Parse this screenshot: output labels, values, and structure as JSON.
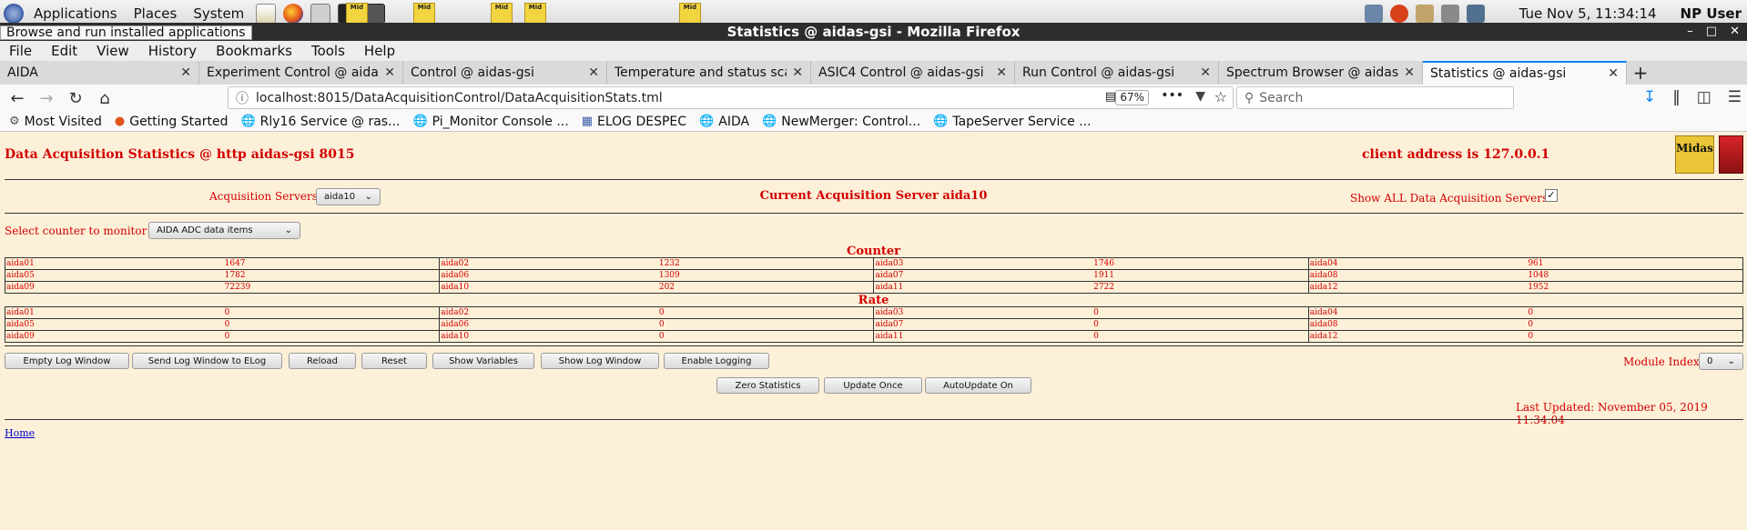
{
  "desktop": {
    "menu": [
      "Applications",
      "Places",
      "System"
    ],
    "clock": "Tue Nov  5, 11:34:14",
    "user": "NP User",
    "tooltip": "Browse and run installed applications"
  },
  "window": {
    "title": "Statistics @ aidas-gsi - Mozilla Firefox"
  },
  "browser": {
    "menu": [
      "File",
      "Edit",
      "View",
      "History",
      "Bookmarks",
      "Tools",
      "Help"
    ],
    "tabs": [
      {
        "label": "AIDA",
        "active": false
      },
      {
        "label": "Experiment Control @ aidas-gsi",
        "active": false
      },
      {
        "label": "Control @ aidas-gsi",
        "active": false
      },
      {
        "label": "Temperature and status scan",
        "active": false
      },
      {
        "label": "ASIC4 Control @ aidas-gsi",
        "active": false
      },
      {
        "label": "Run Control @ aidas-gsi",
        "active": false
      },
      {
        "label": "Spectrum Browser @ aidas-gsi",
        "active": false
      },
      {
        "label": "Statistics @ aidas-gsi",
        "active": true
      }
    ],
    "url": "localhost:8015/DataAcquisitionControl/DataAcquisitionStats.tml",
    "zoom": "67%",
    "search_placeholder": "Search",
    "bookmarks": [
      "Most Visited",
      "Getting Started",
      "Rly16 Service @ ras...",
      "Pi_Monitor Console ...",
      "ELOG DESPEC",
      "AIDA",
      "NewMerger: Control...",
      "TapeServer Service ..."
    ]
  },
  "page": {
    "title": "Data Acquisition Statistics @ http aidas-gsi 8015",
    "client": "client address is 127.0.0.1",
    "logo_text": "Midas",
    "acq_servers_label": "Acquisition Servers",
    "acq_server_selected": "aida10",
    "current_server": "Current Acquisition Server aida10",
    "show_all_label": "Show ALL Data Acquisition Servers?",
    "show_all_checked": true,
    "counter_label": "Select counter to monitor",
    "counter_selected": "AIDA ADC data items",
    "counter_heading": "Counter",
    "rate_heading": "Rate",
    "counters": [
      [
        [
          "aida01",
          "1647"
        ],
        [
          "aida02",
          "1232"
        ],
        [
          "aida03",
          "1746"
        ],
        [
          "aida04",
          "961"
        ]
      ],
      [
        [
          "aida05",
          "1782"
        ],
        [
          "aida06",
          "1309"
        ],
        [
          "aida07",
          "1911"
        ],
        [
          "aida08",
          "1048"
        ]
      ],
      [
        [
          "aida09",
          "72239"
        ],
        [
          "aida10",
          "202"
        ],
        [
          "aida11",
          "2722"
        ],
        [
          "aida12",
          "1952"
        ]
      ]
    ],
    "rates": [
      [
        [
          "aida01",
          "0"
        ],
        [
          "aida02",
          "0"
        ],
        [
          "aida03",
          "0"
        ],
        [
          "aida04",
          "0"
        ]
      ],
      [
        [
          "aida05",
          "0"
        ],
        [
          "aida06",
          "0"
        ],
        [
          "aida07",
          "0"
        ],
        [
          "aida08",
          "0"
        ]
      ],
      [
        [
          "aida09",
          "0"
        ],
        [
          "aida10",
          "0"
        ],
        [
          "aida11",
          "0"
        ],
        [
          "aida12",
          "0"
        ]
      ]
    ],
    "buttons": [
      "Empty Log Window",
      "Send Log Window to ELog",
      "Reload",
      "Reset",
      "Show Variables",
      "Show Log Window",
      "Enable Logging"
    ],
    "module_index_label": "Module Index",
    "module_index_value": "0",
    "stats_buttons": [
      "Zero Statistics",
      "Update Once",
      "AutoUpdate On"
    ],
    "last_updated": "Last Updated: November 05, 2019 11:34:04",
    "home_link": "Home"
  }
}
